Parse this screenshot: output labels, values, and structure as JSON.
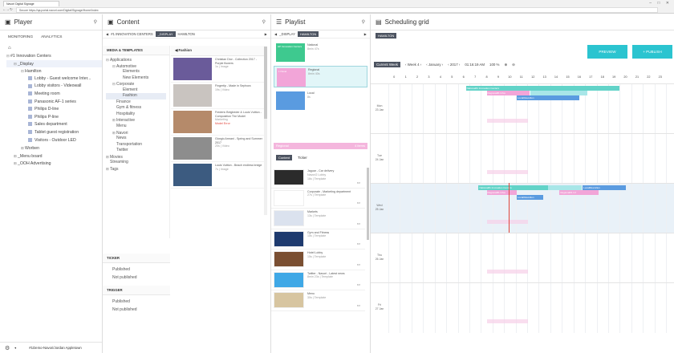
{
  "browser": {
    "tab_title": "Navori Digital Signage",
    "address": "Secure  https://qa.portal.navori.com/Digital/Signage/Home/Index"
  },
  "player": {
    "title": "Player",
    "nav": [
      "MONITORING",
      "ANALYTICS"
    ],
    "tree": [
      {
        "label": "#1 Innovation Centers",
        "level": 0,
        "pm": "⊟"
      },
      {
        "label": "_Display",
        "level": 1,
        "pm": "⊟",
        "selected": true
      },
      {
        "label": "Hamilton",
        "level": 2,
        "pm": "⊟"
      },
      {
        "label": "Lobby - Guest welcome Inter...",
        "level": 3,
        "sq": true
      },
      {
        "label": "Lobby visitors - Videowall",
        "level": 3,
        "sq": true
      },
      {
        "label": "Meeting room",
        "level": 3,
        "sq": true
      },
      {
        "label": "Panasonic AF-1 series",
        "level": 3,
        "sq": true
      },
      {
        "label": "Philips D-line",
        "level": 3,
        "sq": true
      },
      {
        "label": "Philips P-line",
        "level": 3,
        "sq": true
      },
      {
        "label": "Sales department",
        "level": 3,
        "sq": true
      },
      {
        "label": "Tablet guest registration",
        "level": 3,
        "sq": true
      },
      {
        "label": "Visitors - Outdoor LED",
        "level": 3,
        "sq": true
      },
      {
        "label": "Worben",
        "level": 2,
        "pm": "⊞"
      },
      {
        "label": "_Menu board",
        "level": 1,
        "pm": "⊞"
      },
      {
        "label": "_OOH Advertising",
        "level": 1,
        "pm": "⊞"
      }
    ],
    "footer": "#1Demo-Navori/Jordan Appletown"
  },
  "content": {
    "title": "Content",
    "crumbs": [
      "#1 INNOVATION CENTERS",
      "_DISPLAY",
      "HAMILTON"
    ],
    "section": "MEDIA & TEMPLATES",
    "folder": "Fashion",
    "tree": [
      {
        "label": "Applications",
        "l": 0,
        "pm": "⊟"
      },
      {
        "label": "Automotive",
        "l": 1,
        "pm": "⊟"
      },
      {
        "label": "Elements",
        "l": 2
      },
      {
        "label": "New Elements",
        "l": 2
      },
      {
        "label": "Corporate",
        "l": 1,
        "pm": "⊟"
      },
      {
        "label": "Element",
        "l": 2
      },
      {
        "label": "Fashion",
        "l": 2,
        "sel": true
      },
      {
        "label": "Finance",
        "l": 1
      },
      {
        "label": "Gym & fitness",
        "l": 1
      },
      {
        "label": "Hospitality",
        "l": 1
      },
      {
        "label": "Interactive",
        "l": 1,
        "pm": "⊞"
      },
      {
        "label": "Menu",
        "l": 1
      },
      {
        "label": "Navori",
        "l": 1,
        "pm": "⊞"
      },
      {
        "label": "News",
        "l": 1
      },
      {
        "label": "Transportation",
        "l": 1
      },
      {
        "label": "Twitter",
        "l": 1
      },
      {
        "label": "Movies",
        "l": 0,
        "pm": "⊞"
      },
      {
        "label": "Streaming",
        "l": 0
      },
      {
        "label": "Tags",
        "l": 0,
        "pm": "⊞"
      }
    ],
    "items": [
      {
        "title": "Christian Dior - Collection 2017 - Purple flowers",
        "sub": "1s | Image",
        "color": "#6a5b9a"
      },
      {
        "title": "Fingertip - Made in Sephora",
        "sub": "19s | Video",
        "color": "#c9c4c0"
      },
      {
        "title": "Frederic Beigbeder & Louis Vuitton - Composition The Model",
        "sub": "Marketing",
        "color": "#b58a6a",
        "warn": "Model Error"
      },
      {
        "title": "Giorgio Armani - Spring and Summer 2017",
        "sub": "20s | Video",
        "color": "#8d8d8d"
      },
      {
        "title": "Louis Vuitton - Beach endless bridge",
        "sub": "7s | Image",
        "color": "#3c5b80"
      }
    ],
    "ticker": {
      "title": "TICKER",
      "items": [
        "Published",
        "Not published"
      ]
    },
    "trigger": {
      "title": "TRIGGER",
      "items": [
        "Published",
        "Not published"
      ]
    }
  },
  "playlist": {
    "title": "Playlist",
    "crumbs": [
      "_DISPLAY",
      "HAMILTON"
    ],
    "items": [
      {
        "title": "National",
        "sub": "8min 47s",
        "color": "#3ec98f",
        "thumb": "HP Innovation Centers"
      },
      {
        "title": "Regional",
        "sub": "8min 40s",
        "color": "#f2a5d8",
        "thumb": "1 Panel"
      },
      {
        "title": "Local",
        "sub": "8s",
        "color": "#5a9be0",
        "thumb": ""
      }
    ],
    "regional_bar": "Regional",
    "regional_time": "4 items",
    "tabs": [
      "Content",
      "Ticker"
    ],
    "tickers": [
      {
        "title": "Jaguar - Car delivery",
        "sub": "Navori2 Lobby",
        "sub2": "16s | Template",
        "color": "#2b2b2b"
      },
      {
        "title": "Corporate - Marketing department",
        "sub": "27s | Template",
        "color": "#ffffff"
      },
      {
        "title": "Markets",
        "sub": "13s | Template",
        "color": "#dbe2ee"
      },
      {
        "title": "Gym and Fitness",
        "sub": "15s | Template",
        "color": "#1e3a6e"
      },
      {
        "title": "Hotel Lobby",
        "sub": "15s | Template",
        "color": "#7a4f32"
      },
      {
        "title": "Twitter - Navori - Latest news",
        "sub": "8min 23s | Template",
        "color": "#3fa8e6"
      },
      {
        "title": "Menu",
        "sub": "30s | Template",
        "color": "#d7c5a0"
      }
    ]
  },
  "schedule": {
    "title": "Scheduling grid",
    "crumb": "HAMILTON",
    "preview": "PREVIEW",
    "publish": "+ PUBLISH",
    "current_week": "Current Week",
    "week": "Week 4",
    "month": "January",
    "year": "2017",
    "time": "01:16:19 AM",
    "zoom": "100 %",
    "hours": [
      "0",
      "1",
      "2",
      "3",
      "4",
      "5",
      "6",
      "7",
      "8",
      "9",
      "10",
      "11",
      "12",
      "13",
      "14",
      "15",
      "16",
      "17",
      "18",
      "19",
      "20",
      "21",
      "22",
      "23"
    ],
    "days": [
      {
        "name": "Mon",
        "date": "23 Jan"
      },
      {
        "name": "Tue",
        "date": "24 Jan"
      },
      {
        "name": "Wed",
        "date": "25 Jan"
      },
      {
        "name": "Thu",
        "date": "26 Jan"
      },
      {
        "name": "Fri",
        "date": "27 Jan"
      }
    ],
    "events": [
      {
        "day": 0,
        "row": 0,
        "start": 6.7,
        "end": 20,
        "color": "#62d3c8",
        "label": "National#1 Innovation Centers"
      },
      {
        "day": 0,
        "row": 1,
        "start": 8.5,
        "end": 12.2,
        "color": "#f2a5d8",
        "label": "Regional#1 Infov"
      },
      {
        "day": 0,
        "row": 1,
        "start": 12.3,
        "end": 17.2,
        "color": "#a8e6e8",
        "label": ""
      },
      {
        "day": 0,
        "row": 2,
        "start": 11.1,
        "end": 16.5,
        "color": "#5a9be0",
        "label": "Local#Hamilton"
      },
      {
        "day": 2,
        "row": 0,
        "start": 7.8,
        "end": 13.8,
        "color": "#62d3c8",
        "label": "National#1 Innovation Centers"
      },
      {
        "day": 2,
        "row": 0,
        "start": 13.8,
        "end": 16.7,
        "color": "#a8e6e8",
        "label": ""
      },
      {
        "day": 2,
        "row": 0,
        "start": 16.8,
        "end": 20.5,
        "color": "#5a9be0",
        "label": "Local#Hamilton"
      },
      {
        "day": 2,
        "row": 1,
        "start": 8.5,
        "end": 11.1,
        "color": "#f2a5d8",
        "label": "Regional#1 Infov"
      },
      {
        "day": 2,
        "row": 1,
        "start": 14.8,
        "end": 18.2,
        "color": "#f2a5d8",
        "label": "Regional#1 Inf"
      },
      {
        "day": 2,
        "row": 2,
        "start": 11.1,
        "end": 13.4,
        "color": "#5a9be0",
        "label": "Local#Hamilton"
      }
    ]
  }
}
